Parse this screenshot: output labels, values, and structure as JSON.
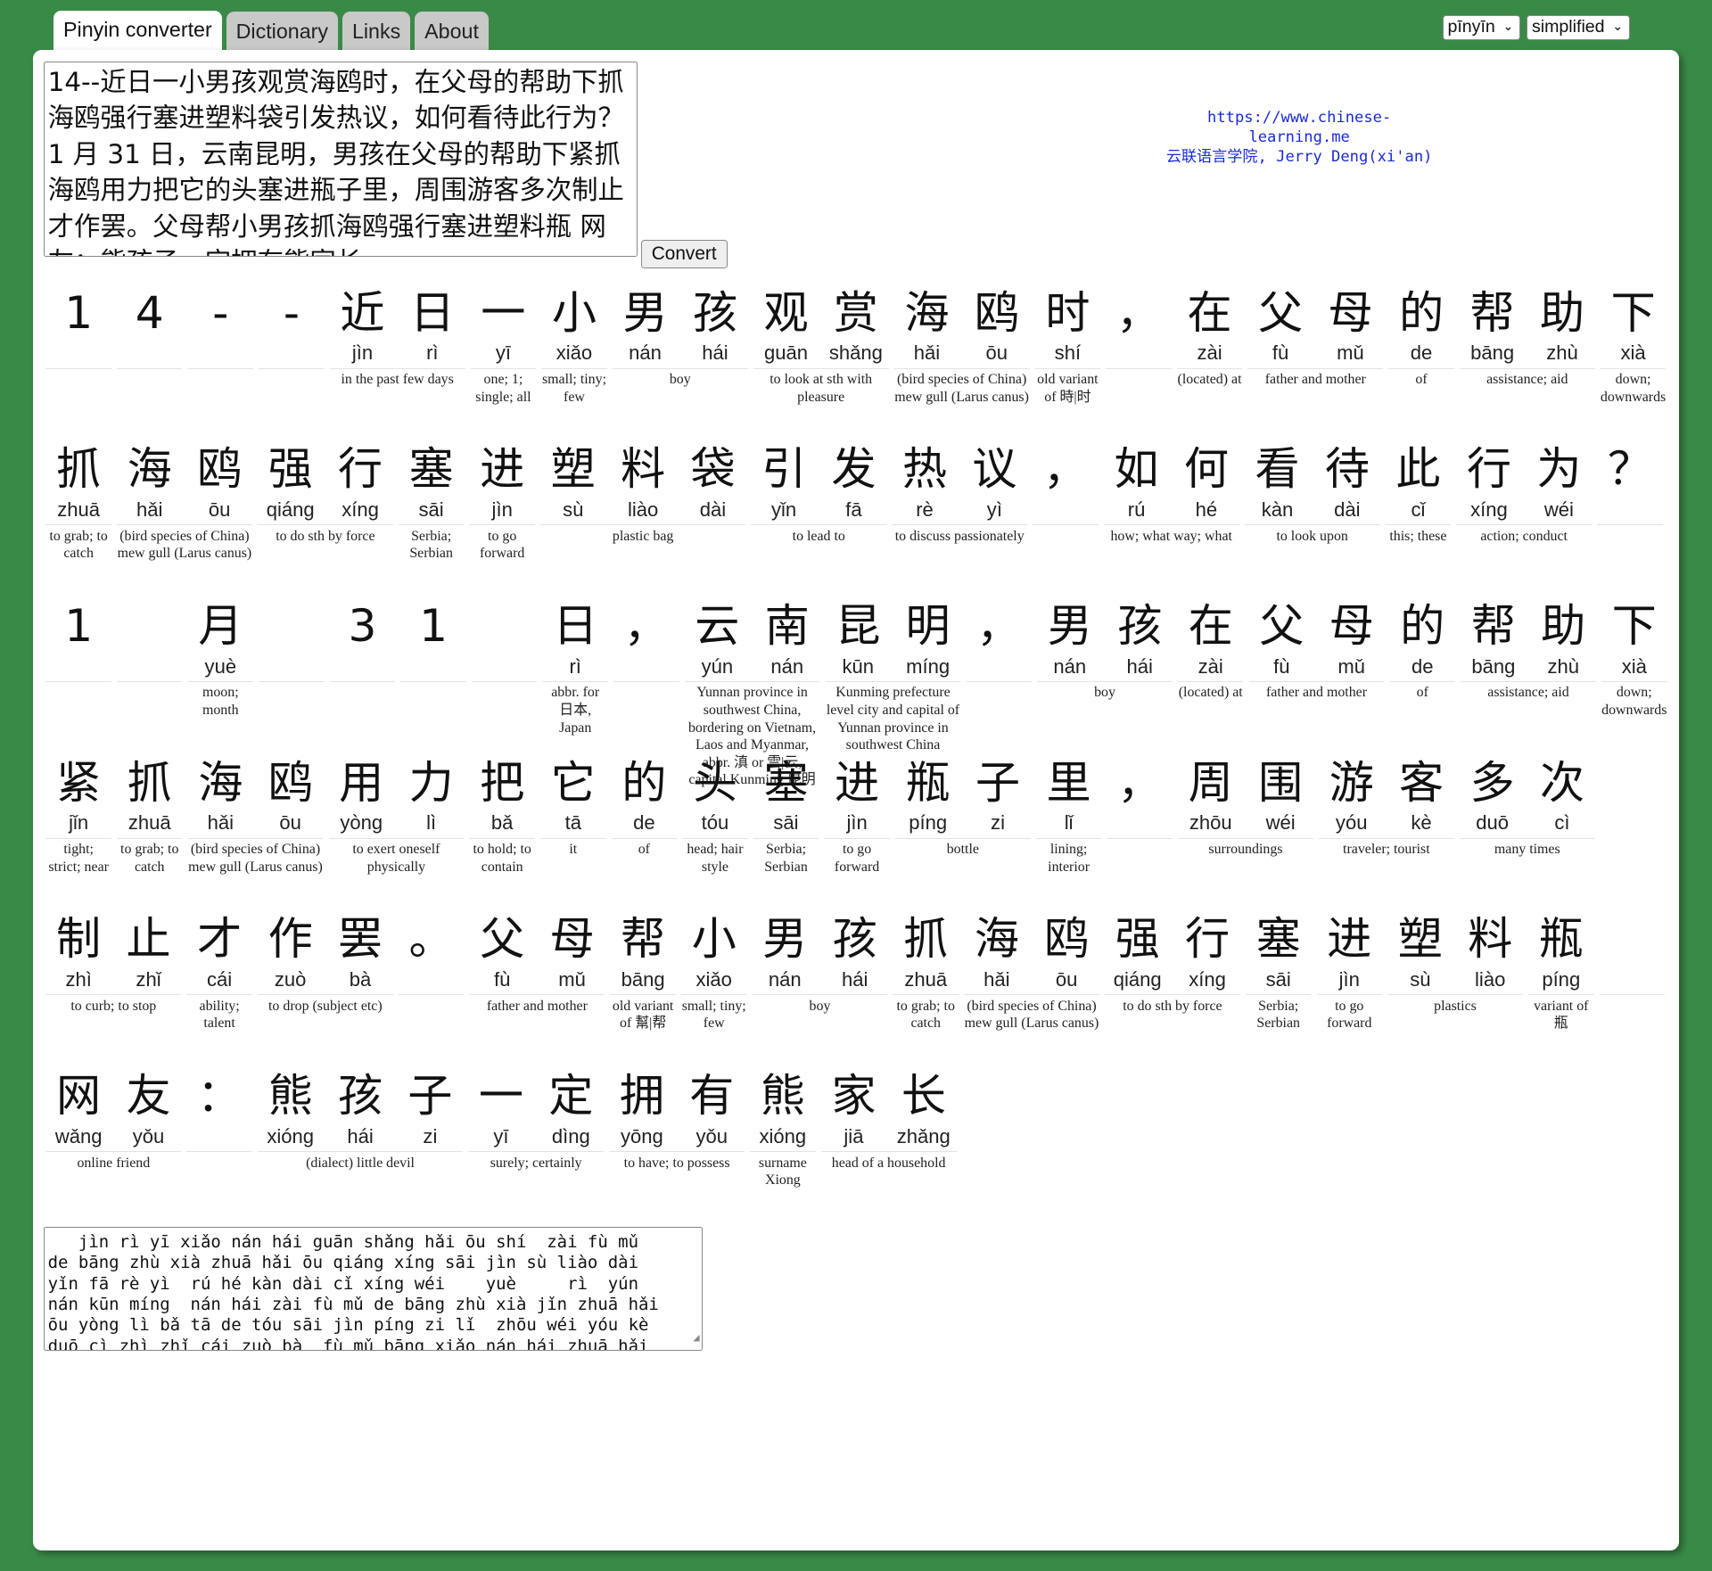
{
  "tabs": [
    {
      "label": "Pinyin converter",
      "active": true
    },
    {
      "label": "Dictionary",
      "active": false
    },
    {
      "label": "Links",
      "active": false
    },
    {
      "label": "About",
      "active": false
    }
  ],
  "selects": {
    "romanization": "pīnyīn",
    "script": "simplified"
  },
  "input_text": "14--近日一小男孩观赏海鸥时，在父母的帮助下抓海鸥强行塞进塑料袋引发热议，如何看待此行为？1 月 31 日，云南昆明，男孩在父母的帮助下紧抓海鸥用力把它的头塞进瓶子里，周围游客多次制止才作罢。父母帮小男孩抓海鸥强行塞进塑料瓶 网友：熊孩子一定拥有熊家长",
  "convert_label": "Convert",
  "credit": {
    "url": "https://www.chinese-learning.me",
    "author": "云联语言学院, Jerry Deng(xi'an)"
  },
  "output_lines": [
    "   jìn rì yī xiǎo nán hái guān shǎng hǎi ōu shí  zài fù mǔ",
    "de bāng zhù xià zhuā hǎi ōu qiáng xíng sāi jìn sù liào dài",
    "yǐn fā rè yì  rú hé kàn dài cǐ xíng wéi    yuè     rì  yún",
    "nán kūn míng  nán hái zài fù mǔ de bāng zhù xià jǐn zhuā hǎi",
    "ōu yòng lì bǎ tā de tóu sāi jìn píng zi lǐ  zhōu wéi yóu kè",
    "duō cì zhì zhǐ cái zuò bà  fù mǔ bāng xiǎo nán hái zhuā hǎi"
  ],
  "rows": [
    [
      {
        "c": [
          [
            "1",
            ""
          ]
        ],
        "d": ""
      },
      {
        "c": [
          [
            "4",
            ""
          ]
        ],
        "d": ""
      },
      {
        "c": [
          [
            "-",
            ""
          ]
        ],
        "d": ""
      },
      {
        "c": [
          [
            "-",
            ""
          ]
        ],
        "d": ""
      },
      {
        "c": [
          [
            "近",
            "jìn"
          ],
          [
            "日",
            "rì"
          ]
        ],
        "d": "in the past few days"
      },
      {
        "c": [
          [
            "一",
            "yī"
          ]
        ],
        "d": "one; 1; single; all"
      },
      {
        "c": [
          [
            "小",
            "xiǎo"
          ]
        ],
        "d": "small; tiny; few"
      },
      {
        "c": [
          [
            "男",
            "nán"
          ],
          [
            "孩",
            "hái"
          ]
        ],
        "d": "boy"
      },
      {
        "c": [
          [
            "观",
            "guān"
          ],
          [
            "赏",
            "shǎng"
          ]
        ],
        "d": "to look at sth with pleasure"
      },
      {
        "c": [
          [
            "海",
            "hǎi"
          ],
          [
            "鸥",
            "ōu"
          ]
        ],
        "d": "(bird species of China) mew gull (Larus canus)"
      },
      {
        "c": [
          [
            "时",
            "shí"
          ]
        ],
        "d": "old variant of 時|时"
      },
      {
        "c": [
          [
            "，",
            ""
          ]
        ],
        "d": ""
      },
      {
        "c": [
          [
            "在",
            "zài"
          ]
        ],
        "d": "(located) at"
      },
      {
        "c": [
          [
            "父",
            "fù"
          ],
          [
            "母",
            "mǔ"
          ]
        ],
        "d": "father and mother"
      },
      {
        "c": [
          [
            "的",
            "de"
          ]
        ],
        "d": "of"
      },
      {
        "c": [
          [
            "帮",
            "bāng"
          ],
          [
            "助",
            "zhù"
          ]
        ],
        "d": "assistance; aid"
      },
      {
        "c": [
          [
            "下",
            "xià"
          ]
        ],
        "d": "down; downwards"
      }
    ],
    [
      {
        "c": [
          [
            "抓",
            "zhuā"
          ]
        ],
        "d": "to grab; to catch"
      },
      {
        "c": [
          [
            "海",
            "hǎi"
          ],
          [
            "鸥",
            "ōu"
          ]
        ],
        "d": "(bird species of China) mew gull (Larus canus)"
      },
      {
        "c": [
          [
            "强",
            "qiáng"
          ],
          [
            "行",
            "xíng"
          ]
        ],
        "d": "to do sth by force"
      },
      {
        "c": [
          [
            "塞",
            "sāi"
          ]
        ],
        "d": "Serbia; Serbian"
      },
      {
        "c": [
          [
            "进",
            "jìn"
          ]
        ],
        "d": "to go forward"
      },
      {
        "c": [
          [
            "塑",
            "sù"
          ],
          [
            "料",
            "liào"
          ],
          [
            "袋",
            "dài"
          ]
        ],
        "d": "plastic bag"
      },
      {
        "c": [
          [
            "引",
            "yǐn"
          ],
          [
            "发",
            "fā"
          ]
        ],
        "d": "to lead to"
      },
      {
        "c": [
          [
            "热",
            "rè"
          ],
          [
            "议",
            "yì"
          ]
        ],
        "d": "to discuss passionately"
      },
      {
        "c": [
          [
            "，",
            ""
          ]
        ],
        "d": ""
      },
      {
        "c": [
          [
            "如",
            "rú"
          ],
          [
            "何",
            "hé"
          ]
        ],
        "d": "how; what way; what"
      },
      {
        "c": [
          [
            "看",
            "kàn"
          ],
          [
            "待",
            "dài"
          ]
        ],
        "d": "to look upon"
      },
      {
        "c": [
          [
            "此",
            "cǐ"
          ]
        ],
        "d": "this; these"
      },
      {
        "c": [
          [
            "行",
            "xíng"
          ],
          [
            "为",
            "wéi"
          ]
        ],
        "d": "action; conduct"
      },
      {
        "c": [
          [
            "？",
            ""
          ]
        ],
        "d": ""
      }
    ],
    [
      {
        "c": [
          [
            "1",
            ""
          ]
        ],
        "d": ""
      },
      {
        "c": [
          [
            "",
            ""
          ]
        ],
        "d": ""
      },
      {
        "c": [
          [
            "月",
            "yuè"
          ]
        ],
        "d": "moon; month"
      },
      {
        "c": [
          [
            "",
            ""
          ]
        ],
        "d": ""
      },
      {
        "c": [
          [
            "3",
            ""
          ]
        ],
        "d": ""
      },
      {
        "c": [
          [
            "1",
            ""
          ]
        ],
        "d": ""
      },
      {
        "c": [
          [
            "",
            ""
          ]
        ],
        "d": ""
      },
      {
        "c": [
          [
            "日",
            "rì"
          ]
        ],
        "d": "abbr. for 日本, Japan"
      },
      {
        "c": [
          [
            "，",
            ""
          ]
        ],
        "d": ""
      },
      {
        "c": [
          [
            "云",
            "yún"
          ],
          [
            "南",
            "nán"
          ]
        ],
        "d": "Yunnan province in southwest China, bordering on Vietnam, Laos and Myanmar, abbr. 滇 or 雲|云, capital Kunming 昆明"
      },
      {
        "c": [
          [
            "昆",
            "kūn"
          ],
          [
            "明",
            "míng"
          ]
        ],
        "d": "Kunming prefecture level city and capital of Yunnan province in southwest China"
      },
      {
        "c": [
          [
            "，",
            ""
          ]
        ],
        "d": ""
      },
      {
        "c": [
          [
            "男",
            "nán"
          ],
          [
            "孩",
            "hái"
          ]
        ],
        "d": "boy"
      },
      {
        "c": [
          [
            "在",
            "zài"
          ]
        ],
        "d": "(located) at"
      },
      {
        "c": [
          [
            "父",
            "fù"
          ],
          [
            "母",
            "mǔ"
          ]
        ],
        "d": "father and mother"
      },
      {
        "c": [
          [
            "的",
            "de"
          ]
        ],
        "d": "of"
      },
      {
        "c": [
          [
            "帮",
            "bāng"
          ],
          [
            "助",
            "zhù"
          ]
        ],
        "d": "assistance; aid"
      },
      {
        "c": [
          [
            "下",
            "xià"
          ]
        ],
        "d": "down; downwards"
      }
    ],
    [
      {
        "c": [
          [
            "紧",
            "jǐn"
          ]
        ],
        "d": "tight; strict; near"
      },
      {
        "c": [
          [
            "抓",
            "zhuā"
          ]
        ],
        "d": "to grab; to catch"
      },
      {
        "c": [
          [
            "海",
            "hǎi"
          ],
          [
            "鸥",
            "ōu"
          ]
        ],
        "d": "(bird species of China) mew gull (Larus canus)"
      },
      {
        "c": [
          [
            "用",
            "yòng"
          ],
          [
            "力",
            "lì"
          ]
        ],
        "d": "to exert oneself physically"
      },
      {
        "c": [
          [
            "把",
            "bǎ"
          ]
        ],
        "d": "to hold; to contain"
      },
      {
        "c": [
          [
            "它",
            "tā"
          ]
        ],
        "d": "it"
      },
      {
        "c": [
          [
            "的",
            "de"
          ]
        ],
        "d": "of"
      },
      {
        "c": [
          [
            "头",
            "tóu"
          ]
        ],
        "d": "head; hair style"
      },
      {
        "c": [
          [
            "塞",
            "sāi"
          ]
        ],
        "d": "Serbia; Serbian"
      },
      {
        "c": [
          [
            "进",
            "jìn"
          ]
        ],
        "d": "to go forward"
      },
      {
        "c": [
          [
            "瓶",
            "píng"
          ],
          [
            "子",
            "zi"
          ]
        ],
        "d": "bottle"
      },
      {
        "c": [
          [
            "里",
            "lǐ"
          ]
        ],
        "d": "lining; interior"
      },
      {
        "c": [
          [
            "，",
            ""
          ]
        ],
        "d": ""
      },
      {
        "c": [
          [
            "周",
            "zhōu"
          ],
          [
            "围",
            "wéi"
          ]
        ],
        "d": "surroundings"
      },
      {
        "c": [
          [
            "游",
            "yóu"
          ],
          [
            "客",
            "kè"
          ]
        ],
        "d": "traveler; tourist"
      },
      {
        "c": [
          [
            "多",
            "duō"
          ],
          [
            "次",
            "cì"
          ]
        ],
        "d": "many times"
      }
    ],
    [
      {
        "c": [
          [
            "制",
            "zhì"
          ],
          [
            "止",
            "zhǐ"
          ]
        ],
        "d": "to curb; to stop"
      },
      {
        "c": [
          [
            "才",
            "cái"
          ]
        ],
        "d": "ability; talent"
      },
      {
        "c": [
          [
            "作",
            "zuò"
          ],
          [
            "罢",
            "bà"
          ]
        ],
        "d": "to drop (subject etc)"
      },
      {
        "c": [
          [
            "。",
            ""
          ]
        ],
        "d": ""
      },
      {
        "c": [
          [
            "父",
            "fù"
          ],
          [
            "母",
            "mǔ"
          ]
        ],
        "d": "father and mother"
      },
      {
        "c": [
          [
            "帮",
            "bāng"
          ]
        ],
        "d": "old variant of 幫|帮"
      },
      {
        "c": [
          [
            "小",
            "xiǎo"
          ]
        ],
        "d": "small; tiny; few"
      },
      {
        "c": [
          [
            "男",
            "nán"
          ],
          [
            "孩",
            "hái"
          ]
        ],
        "d": "boy"
      },
      {
        "c": [
          [
            "抓",
            "zhuā"
          ]
        ],
        "d": "to grab; to catch"
      },
      {
        "c": [
          [
            "海",
            "hǎi"
          ],
          [
            "鸥",
            "ōu"
          ]
        ],
        "d": "(bird species of China) mew gull (Larus canus)"
      },
      {
        "c": [
          [
            "强",
            "qiáng"
          ],
          [
            "行",
            "xíng"
          ]
        ],
        "d": "to do sth by force"
      },
      {
        "c": [
          [
            "塞",
            "sāi"
          ]
        ],
        "d": "Serbia; Serbian"
      },
      {
        "c": [
          [
            "进",
            "jìn"
          ]
        ],
        "d": "to go forward"
      },
      {
        "c": [
          [
            "塑",
            "sù"
          ],
          [
            "料",
            "liào"
          ]
        ],
        "d": "plastics"
      },
      {
        "c": [
          [
            "瓶",
            "píng"
          ]
        ],
        "d": "variant of 瓶"
      },
      {
        "c": [
          [
            "",
            ""
          ]
        ],
        "d": ""
      }
    ],
    [
      {
        "c": [
          [
            "网",
            "wǎng"
          ],
          [
            "友",
            "yǒu"
          ]
        ],
        "d": "online friend"
      },
      {
        "c": [
          [
            "：",
            ""
          ]
        ],
        "d": ""
      },
      {
        "c": [
          [
            "熊",
            "xióng"
          ],
          [
            "孩",
            "hái"
          ],
          [
            "子",
            "zi"
          ]
        ],
        "d": "(dialect) little devil"
      },
      {
        "c": [
          [
            "一",
            "yī"
          ],
          [
            "定",
            "dìng"
          ]
        ],
        "d": "surely; certainly"
      },
      {
        "c": [
          [
            "拥",
            "yōng"
          ],
          [
            "有",
            "yǒu"
          ]
        ],
        "d": "to have; to possess"
      },
      {
        "c": [
          [
            "熊",
            "xióng"
          ]
        ],
        "d": "surname Xiong"
      },
      {
        "c": [
          [
            "家",
            "jiā"
          ],
          [
            "长",
            "zhǎng"
          ]
        ],
        "d": "head of a household"
      }
    ]
  ]
}
